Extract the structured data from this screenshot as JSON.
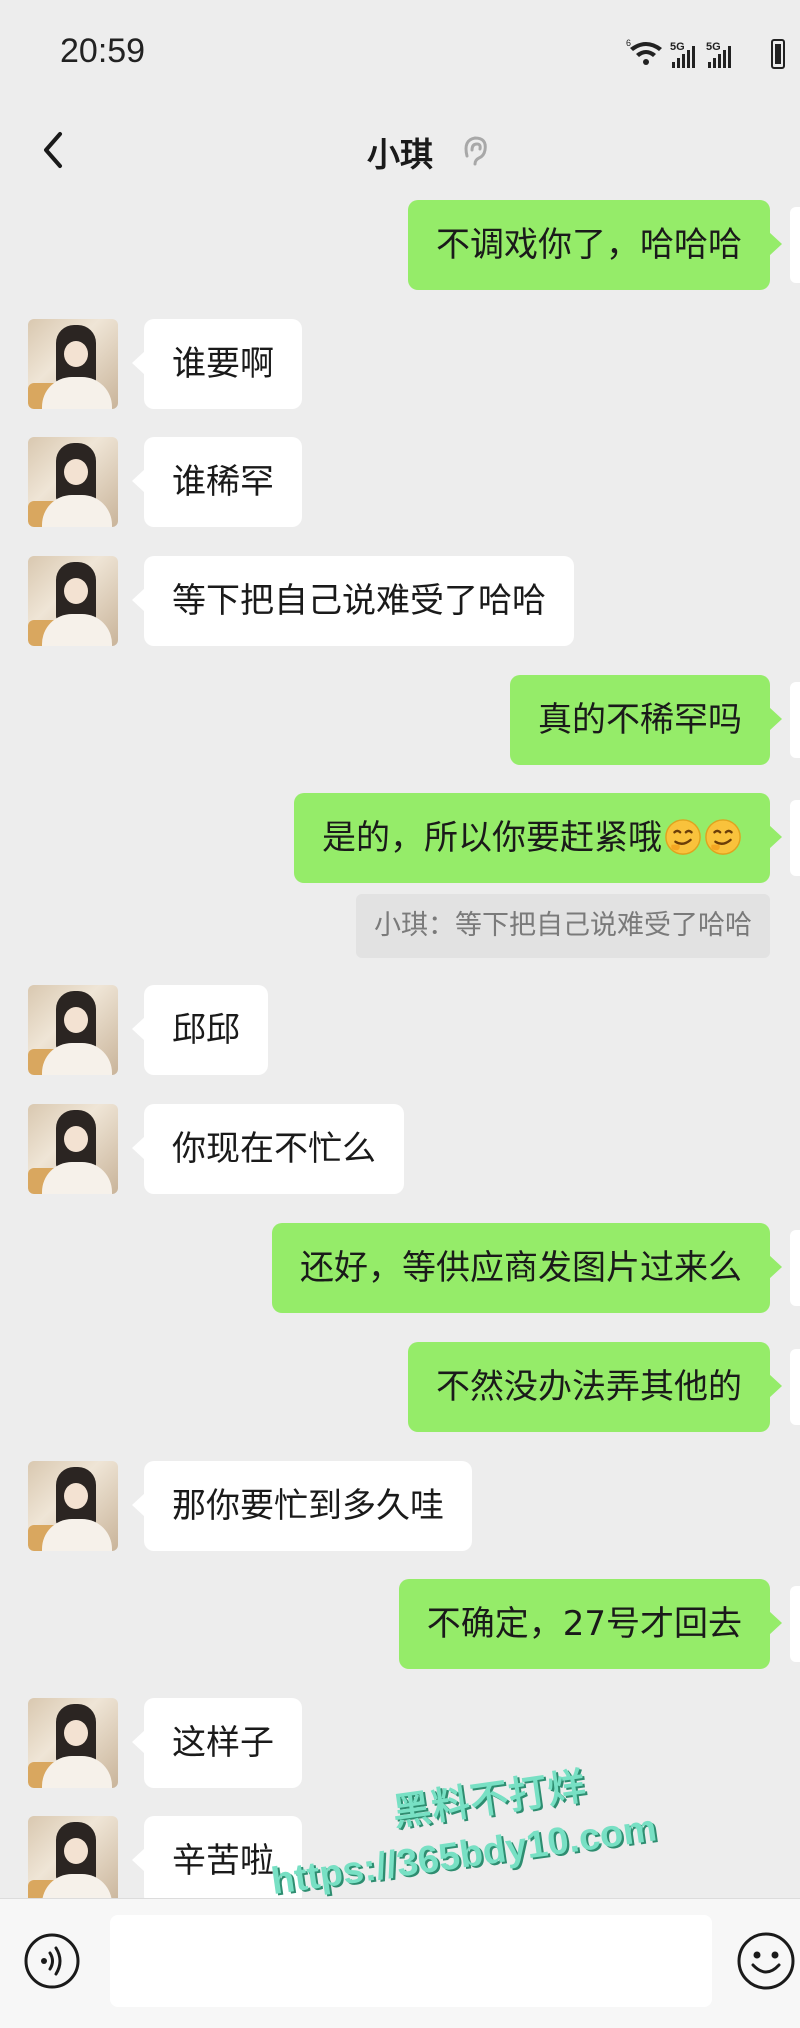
{
  "status_bar": {
    "time": "20:59"
  },
  "header": {
    "title": "小琪"
  },
  "messages": [
    {
      "side": "out",
      "text": "不调戏你了，哈哈哈"
    },
    {
      "side": "in",
      "text": "谁要啊"
    },
    {
      "side": "in",
      "text": "谁稀罕"
    },
    {
      "side": "in",
      "text": "等下把自己说难受了哈哈"
    },
    {
      "side": "out",
      "text": "真的不稀罕吗"
    },
    {
      "side": "out",
      "text": "是的，所以你要赶紧哦",
      "emojis": [
        "smirk-face",
        "smirk-face"
      ]
    },
    {
      "side": "in",
      "text": "邱邱"
    },
    {
      "side": "in",
      "text": "你现在不忙么"
    },
    {
      "side": "out",
      "text": "还好，等供应商发图片过来么"
    },
    {
      "side": "out",
      "text": "不然没办法弄其他的"
    },
    {
      "side": "in",
      "text": "那你要忙到多久哇"
    },
    {
      "side": "out",
      "text": "不确定，27号才回去"
    },
    {
      "side": "in",
      "text": "这样子"
    },
    {
      "side": "in",
      "text": "辛苦啦"
    }
  ],
  "quote": {
    "text": "小琪：等下把自己说难受了哈哈"
  },
  "watermark": {
    "line1": "黑料不打烊",
    "line2": "https://365bdy10.com"
  },
  "input_bar": {
    "value": ""
  },
  "colors": {
    "background": "#ededed",
    "outgoing_bubble": "#95ec69",
    "incoming_bubble": "#ffffff"
  }
}
